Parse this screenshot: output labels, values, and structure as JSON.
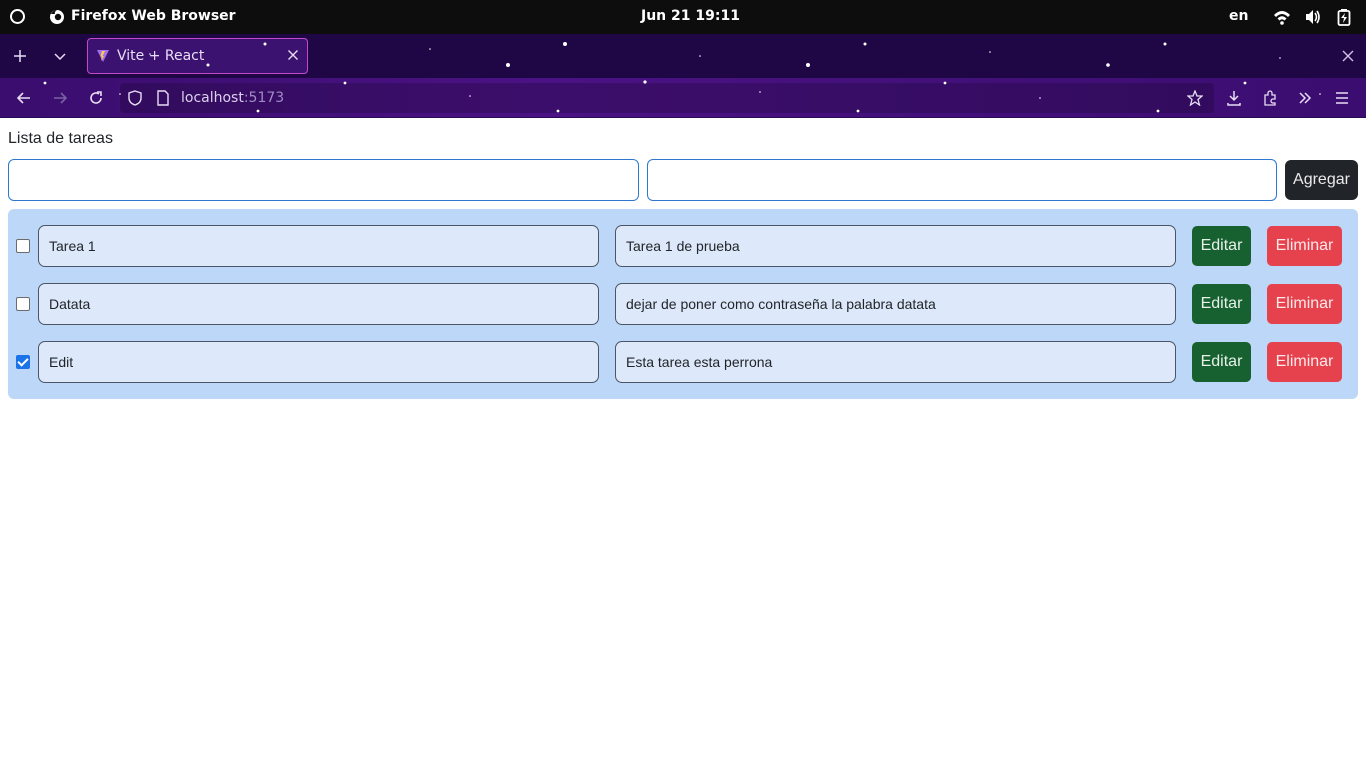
{
  "system": {
    "app_name": "Firefox Web Browser",
    "clock": "Jun 21  19:11",
    "language": "en"
  },
  "browser": {
    "tab_title": "Vite + React",
    "url_host": "localhost",
    "url_port": ":5173",
    "accent_color": "#c24ac8"
  },
  "page": {
    "heading": "Lista de tareas",
    "add_button": "Agregar",
    "tasks": [
      {
        "title": "Tarea 1",
        "description": "Tarea 1 de prueba",
        "done": false,
        "edit_label": "Editar",
        "delete_label": "Eliminar"
      },
      {
        "title": "Datata",
        "description": "dejar de poner como contraseña la palabra datata",
        "done": false,
        "edit_label": "Editar",
        "delete_label": "Eliminar"
      },
      {
        "title": "Edit",
        "description": "Esta tarea esta perrona",
        "done": true,
        "edit_label": "Editar",
        "delete_label": "Eliminar"
      }
    ]
  },
  "colors": {
    "edit_button": "#17602f",
    "delete_button": "#e5424d",
    "list_background": "#bcd7f7",
    "add_button": "#212529"
  }
}
